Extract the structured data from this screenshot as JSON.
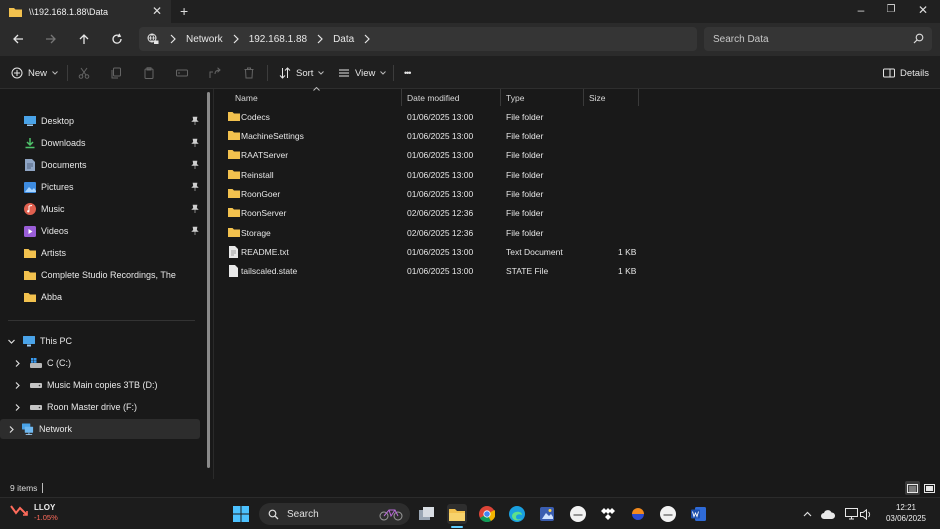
{
  "tab": {
    "title": "\\\\192.168.1.88\\Data"
  },
  "address": {
    "segments": [
      "Network",
      "192.168.1.88",
      "Data"
    ]
  },
  "search": {
    "placeholder": "Search Data"
  },
  "commands": {
    "new_label": "New",
    "sort_label": "Sort",
    "view_label": "View",
    "more_label": "•••",
    "details_label": "Details"
  },
  "sidebar": {
    "quick": [
      {
        "label": "Desktop",
        "icon": "desktop-icon",
        "pinned": true
      },
      {
        "label": "Downloads",
        "icon": "downloads-icon",
        "pinned": true
      },
      {
        "label": "Documents",
        "icon": "documents-icon",
        "pinned": true
      },
      {
        "label": "Pictures",
        "icon": "pictures-icon",
        "pinned": true
      },
      {
        "label": "Music",
        "icon": "music-icon",
        "pinned": true
      },
      {
        "label": "Videos",
        "icon": "videos-icon",
        "pinned": true
      },
      {
        "label": "Artists",
        "icon": "folder-icon",
        "pinned": false
      },
      {
        "label": "Complete Studio Recordings, The",
        "icon": "folder-icon",
        "pinned": false
      },
      {
        "label": "Abba",
        "icon": "folder-icon",
        "pinned": false
      }
    ],
    "this_pc": "This PC",
    "drives": [
      {
        "label": "C (C:)",
        "icon": "windows-drive-icon"
      },
      {
        "label": "Music Main copies 3TB (D:)",
        "icon": "drive-icon"
      },
      {
        "label": "Roon Master drive (F:)",
        "icon": "drive-icon"
      }
    ],
    "network": "Network"
  },
  "columns": {
    "name": "Name",
    "date": "Date modified",
    "type": "Type",
    "size": "Size"
  },
  "files": [
    {
      "name": "Codecs",
      "date": "01/06/2025 13:00",
      "type": "File folder",
      "size": "",
      "kind": "folder"
    },
    {
      "name": "MachineSettings",
      "date": "01/06/2025 13:00",
      "type": "File folder",
      "size": "",
      "kind": "folder"
    },
    {
      "name": "RAATServer",
      "date": "01/06/2025 13:00",
      "type": "File folder",
      "size": "",
      "kind": "folder"
    },
    {
      "name": "Reinstall",
      "date": "01/06/2025 13:00",
      "type": "File folder",
      "size": "",
      "kind": "folder"
    },
    {
      "name": "RoonGoer",
      "date": "01/06/2025 13:00",
      "type": "File folder",
      "size": "",
      "kind": "folder"
    },
    {
      "name": "RoonServer",
      "date": "02/06/2025 12:36",
      "type": "File folder",
      "size": "",
      "kind": "folder"
    },
    {
      "name": "Storage",
      "date": "02/06/2025 12:36",
      "type": "File folder",
      "size": "",
      "kind": "folder"
    },
    {
      "name": "README.txt",
      "date": "01/06/2025 13:00",
      "type": "Text Document",
      "size": "1 KB",
      "kind": "file"
    },
    {
      "name": "tailscaled.state",
      "date": "01/06/2025 13:00",
      "type": "STATE File",
      "size": "1 KB",
      "kind": "file"
    }
  ],
  "status": {
    "item_count": "9 items"
  },
  "taskbar": {
    "stock_name": "LLOY",
    "stock_change": "-1.05%",
    "search_label": "Search",
    "time": "12:21",
    "date": "03/06/2025"
  },
  "colors": {
    "folder": "#f2c14e",
    "accent": "#60cdff",
    "background": "#191919"
  }
}
